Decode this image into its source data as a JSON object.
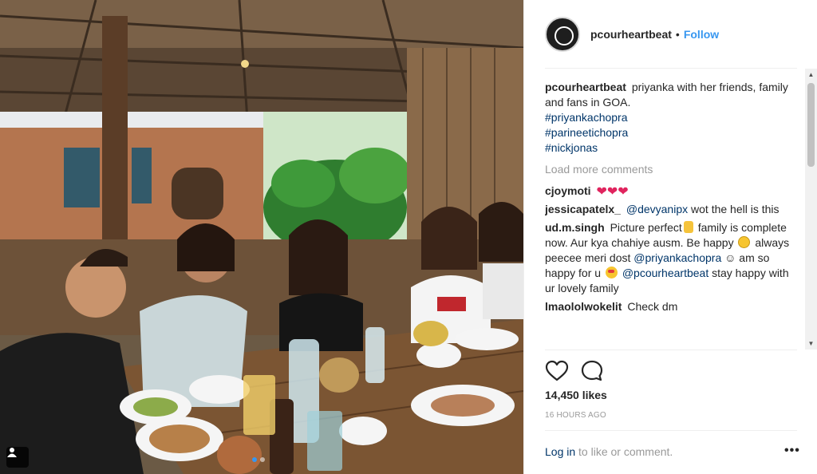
{
  "post": {
    "photo_alt": "",
    "carousel": {
      "total": 2,
      "active_index": 0
    }
  },
  "header": {
    "username": "pcourheartbeat",
    "separator": "•",
    "follow_label": "Follow"
  },
  "caption": {
    "username": "pcourheartbeat",
    "text": "priyanka with her friends, family and fans in GOA.",
    "hashtags": [
      "#priyankachopra",
      "#parineetichopra",
      "#nickjonas"
    ]
  },
  "load_more_label": "Load more comments",
  "comments": [
    {
      "username": "cjoymoti",
      "parts": [
        {
          "type": "emoji",
          "name": "heart-emoji"
        },
        {
          "type": "emoji",
          "name": "heart-emoji"
        },
        {
          "type": "emoji",
          "name": "heart-emoji"
        }
      ]
    },
    {
      "username": "jessicapatelx_",
      "parts": [
        {
          "type": "mention",
          "text": "@devyanipx"
        },
        {
          "type": "text",
          "text": " wot the hell is this"
        }
      ]
    },
    {
      "username": "ud.m.singh",
      "parts": [
        {
          "type": "text",
          "text": "Picture perfect"
        },
        {
          "type": "emoji",
          "name": "ok-hand-emoji"
        },
        {
          "type": "text",
          "text": " family is complete now. Aur kya chahiye ausm. Be happy "
        },
        {
          "type": "emoji",
          "name": "smile-emoji"
        },
        {
          "type": "text",
          "text": " always peecee meri dost "
        },
        {
          "type": "mention",
          "text": "@priyankachopra"
        },
        {
          "type": "text",
          "text": " ☺ am so happy for u "
        },
        {
          "type": "emoji",
          "name": "star-struck-emoji"
        },
        {
          "type": "text",
          "text": " "
        },
        {
          "type": "mention",
          "text": "@pcourheartbeat"
        },
        {
          "type": "text",
          "text": " stay happy with ur lovely family"
        }
      ]
    },
    {
      "username": "lmaololwokelit",
      "parts": [
        {
          "type": "text",
          "text": "Check dm"
        }
      ]
    }
  ],
  "actions": {
    "like_icon": "heart-outline-icon",
    "comment_icon": "speech-bubble-icon"
  },
  "likes_text": "14,450 likes",
  "timestamp": "16 HOURS AGO",
  "login": {
    "link_text": "Log in",
    "rest_text": " to like or comment."
  },
  "more_options": "•••",
  "colors": {
    "link_blue": "#3897f0",
    "mention_blue": "#003569",
    "muted_gray": "#999999",
    "heart_red": "#e0245e"
  }
}
